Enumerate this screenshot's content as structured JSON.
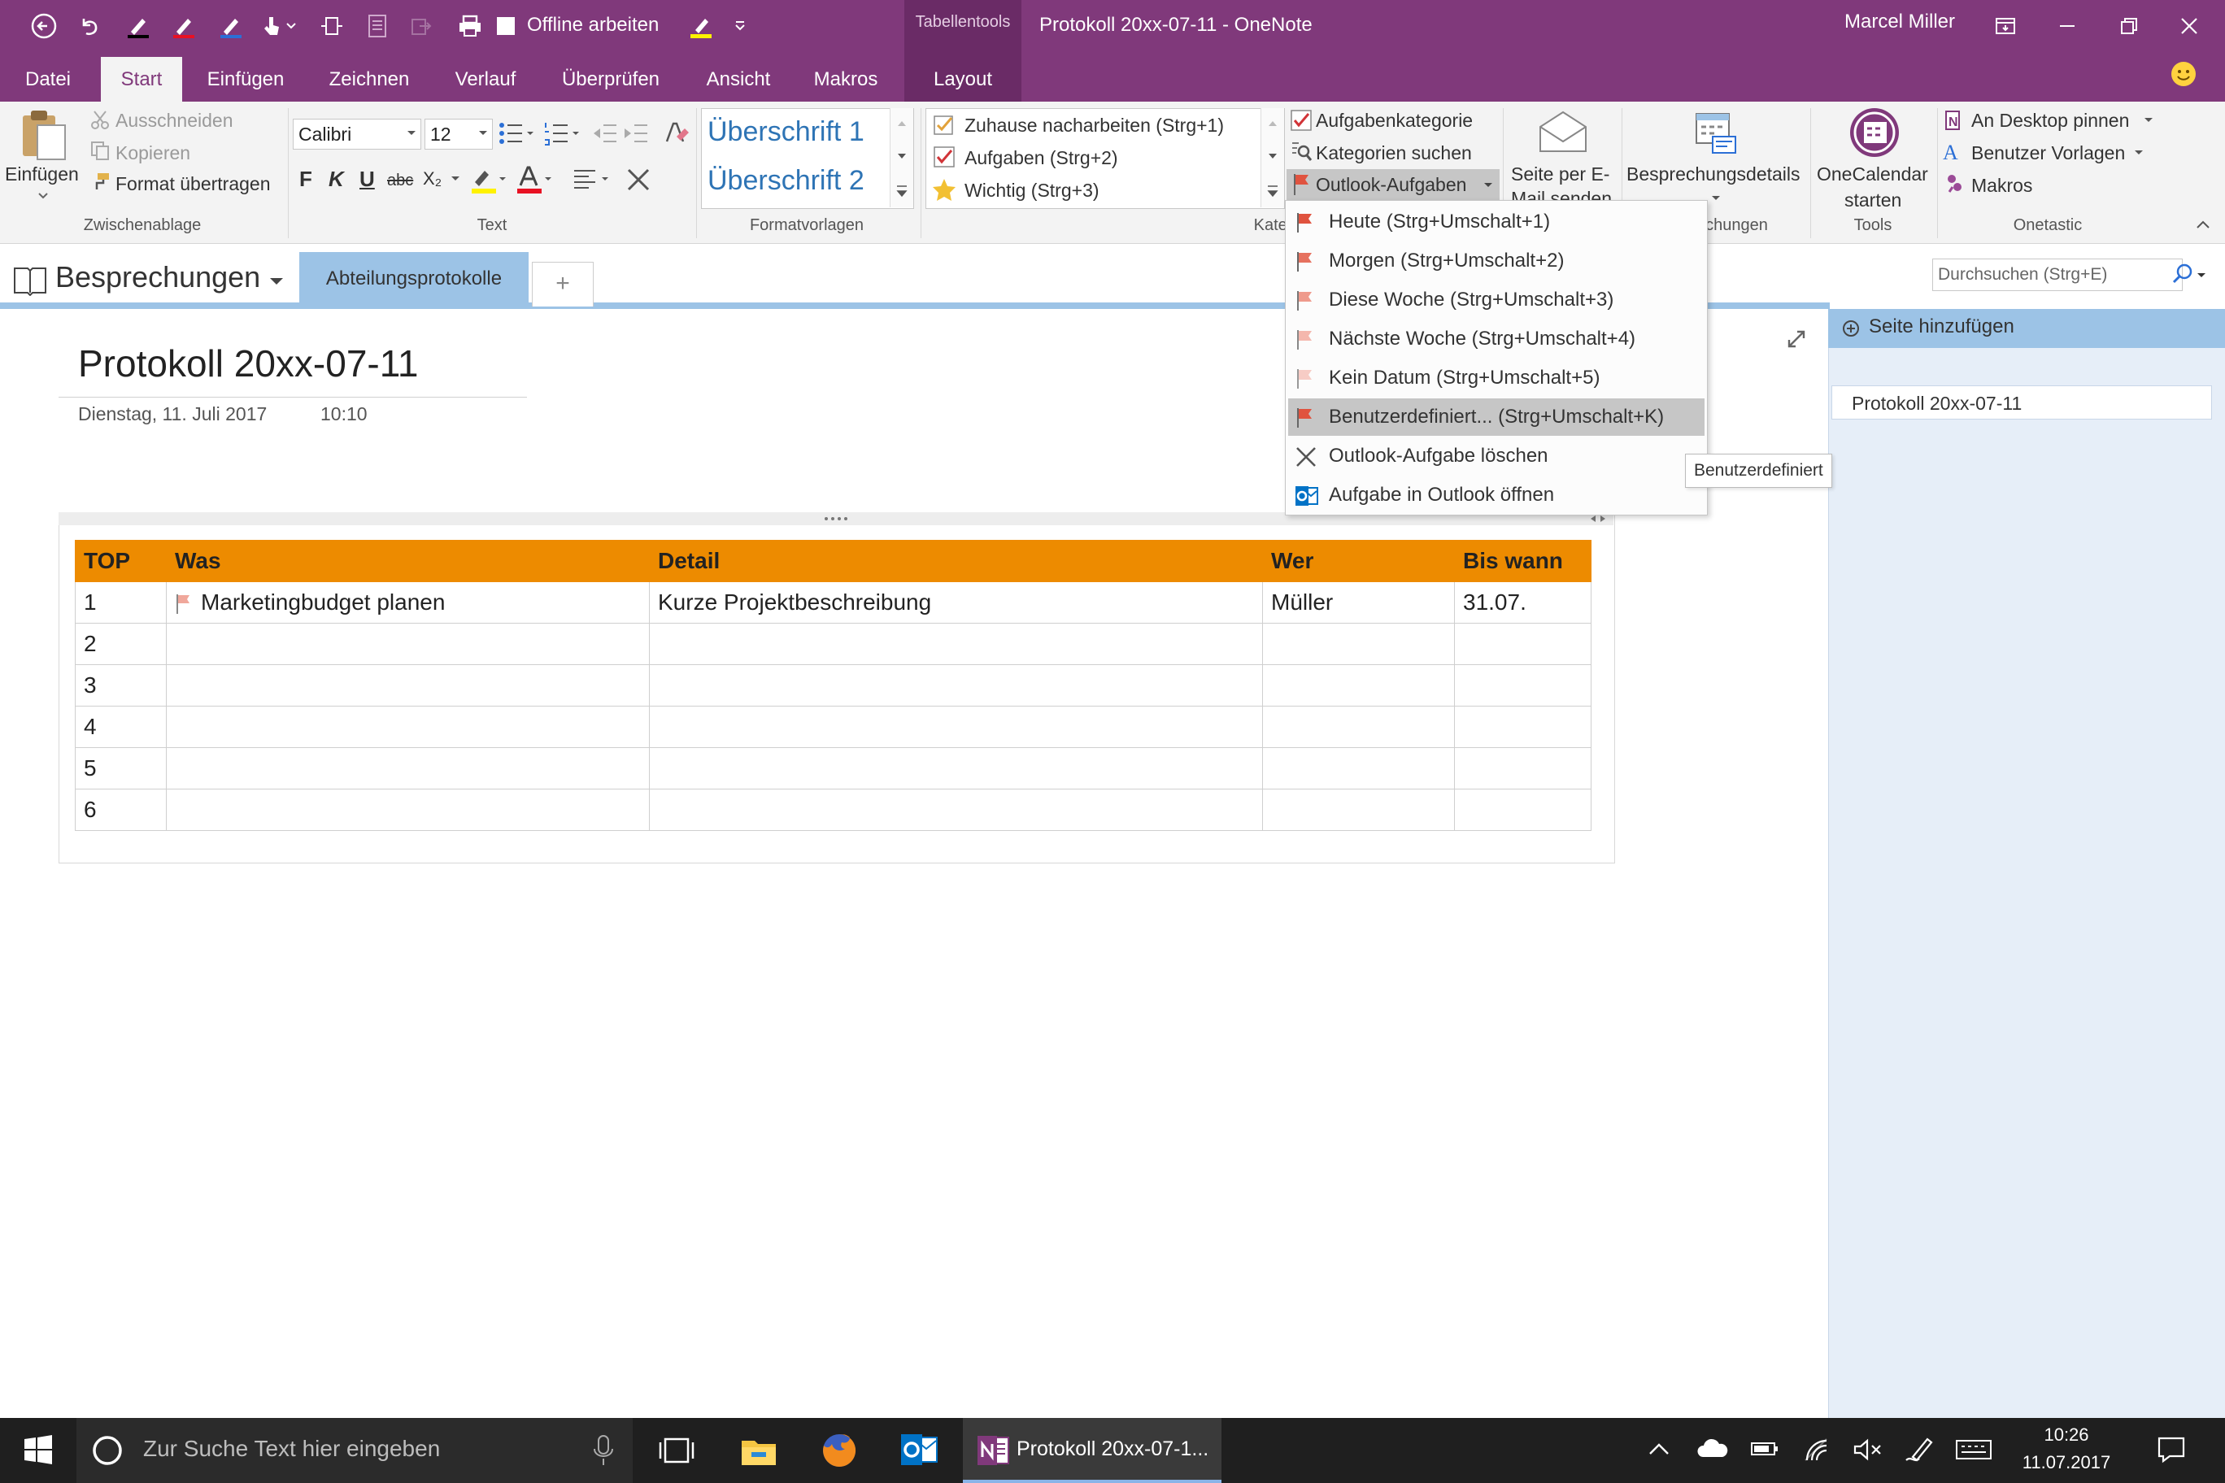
{
  "app": {
    "window_title": "Protokoll 20xx-07-11  -  OneNote",
    "context_label": "Tabellentools",
    "user_name": "Marcel Miller",
    "offline_label": "Offline arbeiten",
    "accent_color": "#80397B"
  },
  "ribbon_tabs": [
    "Datei",
    "Start",
    "Einfügen",
    "Zeichnen",
    "Verlauf",
    "Überprüfen",
    "Ansicht",
    "Makros",
    "Layout"
  ],
  "clipboard": {
    "paste": "Einfügen",
    "cut": "Ausschneiden",
    "copy": "Kopieren",
    "format_painter": "Format übertragen",
    "group": "Zwischenablage"
  },
  "text": {
    "font": "Calibri",
    "size": "12",
    "bold": "F",
    "italic": "K",
    "underline": "U",
    "strike": "abc",
    "subscript": "X₂",
    "group": "Text"
  },
  "styles": {
    "heading1": "Überschrift 1",
    "heading2": "Überschrift 2",
    "group": "Formatvorlagen"
  },
  "tags": {
    "items": [
      "Zuhause nacharbeiten (Strg+1)",
      "Aufgaben (Strg+2)",
      "Wichtig (Strg+3)"
    ],
    "group": "Kategorien",
    "task_category": "Aufgabenkategorie",
    "find_tags": "Kategorien suchen",
    "outlook_tasks": "Outlook-Aufgaben"
  },
  "email": {
    "line1": "Seite per E-",
    "line2": "Mail senden"
  },
  "meetings": {
    "details": "Besprechungsdetails",
    "group": "Besprechungen",
    "group_visible": "echungen"
  },
  "tools": {
    "onecal_line1": "OneCalendar",
    "onecal_line2": "starten",
    "group": "Tools"
  },
  "onetastic": {
    "pin": "An Desktop pinnen",
    "templates": "Benutzer Vorlagen",
    "macros": "Makros",
    "group": "Onetastic"
  },
  "notebook": {
    "name": "Besprechungen",
    "section": "Abteilungsprotokolle",
    "add_section": "+"
  },
  "search": {
    "placeholder": "Durchsuchen (Strg+E)"
  },
  "page": {
    "title": "Protokoll 20xx-07-11",
    "date": "Dienstag, 11. Juli 2017",
    "time": "10:10"
  },
  "table": {
    "headers": [
      "TOP",
      "Was",
      "Detail",
      "Wer",
      "Bis wann"
    ],
    "rows": [
      [
        "1",
        "Marketingbudget planen",
        "Kurze Projektbeschreibung",
        "Müller",
        "31.07."
      ],
      [
        "2",
        "",
        "",
        "",
        ""
      ],
      [
        "3",
        "",
        "",
        "",
        ""
      ],
      [
        "4",
        "",
        "",
        "",
        ""
      ],
      [
        "5",
        "",
        "",
        "",
        ""
      ],
      [
        "6",
        "",
        "",
        "",
        ""
      ]
    ],
    "header_color": "#ED8B00"
  },
  "pages_pane": {
    "add_page": "Seite hinzufügen",
    "pages": [
      "Protokoll 20xx-07-11"
    ]
  },
  "menu": {
    "items": [
      {
        "label": "Heute  (Strg+Umschalt+1)",
        "icon": "flag-red-icon"
      },
      {
        "label": "Morgen  (Strg+Umschalt+2)",
        "icon": "flag-red-icon"
      },
      {
        "label": "Diese Woche  (Strg+Umschalt+3)",
        "icon": "flag-pink-icon"
      },
      {
        "label": "Nächste Woche  (Strg+Umschalt+4)",
        "icon": "flag-pink-icon"
      },
      {
        "label": "Kein Datum  (Strg+Umschalt+5)",
        "icon": "flag-pink-icon"
      },
      {
        "label": "Benutzerdefiniert...  (Strg+Umschalt+K)",
        "icon": "flag-red-icon"
      },
      {
        "label": "Outlook-Aufgabe löschen",
        "icon": "x-icon"
      },
      {
        "label": "Aufgabe in Outlook öffnen",
        "icon": "outlook-icon"
      }
    ],
    "tooltip": "Benutzerdefiniert"
  },
  "taskbar": {
    "search_placeholder": "Zur Suche Text hier eingeben",
    "active_app": "Protokoll 20xx-07-1...",
    "time": "10:26",
    "date": "11.07.2017"
  }
}
